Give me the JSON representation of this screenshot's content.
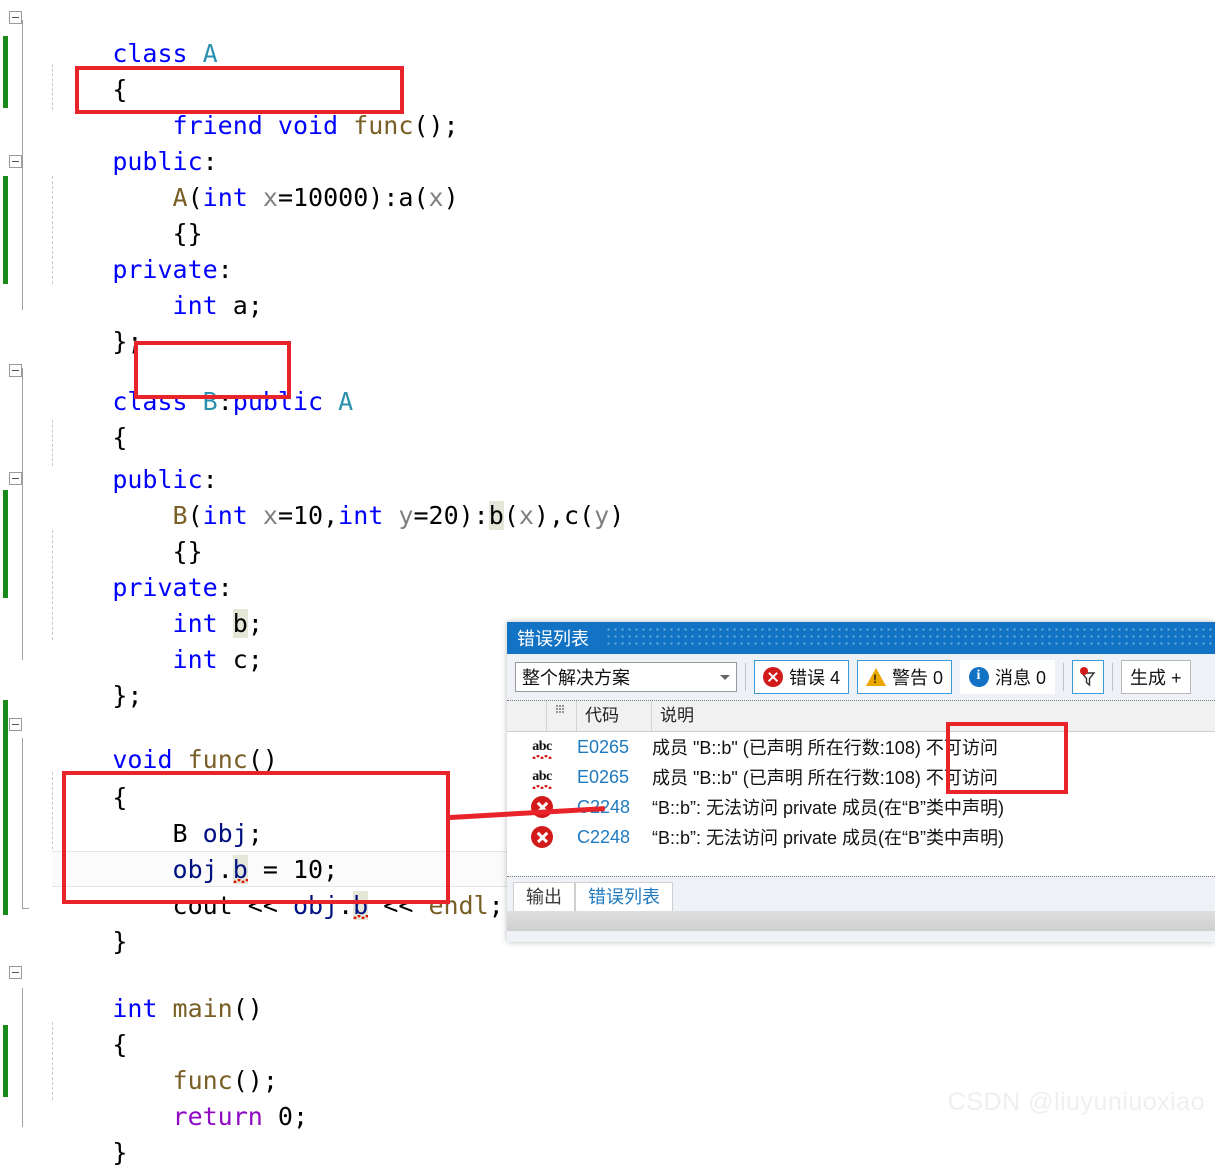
{
  "editor": {
    "language": "cpp",
    "lines": [
      {
        "indent": 0,
        "text": "class A",
        "fold": "open",
        "change": false
      },
      {
        "indent": 0,
        "text": "{",
        "fold": null,
        "change": true
      },
      {
        "indent": 1,
        "text": "friend void func();",
        "fold": null,
        "change": true
      },
      {
        "indent": 0,
        "text": "public:",
        "fold": null,
        "change": true
      },
      {
        "indent": 1,
        "text": "A(int x=10000):a(x)",
        "fold": "open",
        "change": false
      },
      {
        "indent": 1,
        "text": "{}",
        "fold": null,
        "change": true
      },
      {
        "indent": 0,
        "text": "private:",
        "fold": null,
        "change": true
      },
      {
        "indent": 1,
        "text": "int a;",
        "fold": null,
        "change": false
      },
      {
        "indent": 0,
        "text": "};",
        "fold": null,
        "change": false
      },
      {
        "indent": 0,
        "text": "",
        "fold": null,
        "change": false
      },
      {
        "indent": 0,
        "text": "class B:public A",
        "fold": "open",
        "change": false
      },
      {
        "indent": 0,
        "text": "{",
        "fold": null,
        "change": false
      },
      {
        "indent": 0,
        "text": "public:",
        "fold": null,
        "change": false
      },
      {
        "indent": 1,
        "text": "B(int x=10,int y=20):b(x),c(y)",
        "fold": "open",
        "change": false
      },
      {
        "indent": 1,
        "text": "{}",
        "fold": null,
        "change": true
      },
      {
        "indent": 0,
        "text": "private:",
        "fold": null,
        "change": true
      },
      {
        "indent": 1,
        "text": "int b;",
        "fold": null,
        "change": true
      },
      {
        "indent": 1,
        "text": "int c;",
        "fold": null,
        "change": true
      },
      {
        "indent": 0,
        "text": "};",
        "fold": null,
        "change": true
      },
      {
        "indent": 0,
        "text": "",
        "fold": null,
        "change": true
      },
      {
        "indent": 0,
        "text": "void func()",
        "fold": "open",
        "change": true
      },
      {
        "indent": 0,
        "text": "{",
        "fold": null,
        "change": true
      },
      {
        "indent": 1,
        "text": "B obj;",
        "fold": null,
        "change": true
      },
      {
        "indent": 1,
        "text": "obj.b = 10;",
        "fold": null,
        "change": true
      },
      {
        "indent": 1,
        "text": "cout << obj.b << endl;",
        "fold": null,
        "change": true
      },
      {
        "indent": 0,
        "text": "}",
        "fold": "end",
        "change": true
      },
      {
        "indent": 0,
        "text": "",
        "fold": null,
        "change": true
      },
      {
        "indent": 0,
        "text": "int main()",
        "fold": "open",
        "change": false
      },
      {
        "indent": 0,
        "text": "{",
        "fold": null,
        "change": false
      },
      {
        "indent": 1,
        "text": "func();",
        "fold": null,
        "change": true
      },
      {
        "indent": 1,
        "text": "return 0;",
        "fold": null,
        "change": true
      },
      {
        "indent": 0,
        "text": "}",
        "fold": null,
        "change": false
      }
    ]
  },
  "annotations": {
    "box_friend_decl": "friend void func();",
    "box_inheritance": "class B:public A",
    "box_func_body": "B obj; obj.b = 10; cout << obj.b << endl;",
    "box_error_col": "不可访问",
    "connector_color": "#e8232a",
    "box_color": "#e8232a"
  },
  "error_panel": {
    "title": "错误列表",
    "scope_filter": {
      "value": "整个解决方案",
      "caret_icon": "chevron-down-icon"
    },
    "counters": [
      {
        "icon": "error-icon",
        "label": "错误 4",
        "count": 4,
        "color": "#d21a1a"
      },
      {
        "icon": "warning-icon",
        "label": "警告 0",
        "count": 0,
        "color": "#e9a800"
      },
      {
        "icon": "info-icon",
        "label": "消息 0",
        "count": 0,
        "color": "#1273c4"
      }
    ],
    "filter_button": {
      "icon": "filter-funnel-icon",
      "badge": true
    },
    "build_button": {
      "label": "生成 +"
    },
    "columns": [
      "",
      "",
      "代码",
      "说明"
    ],
    "rows": [
      {
        "icon": "abc-squiggle-icon",
        "code": "E0265",
        "description": "成员 \"B::b\" (已声明 所在行数:108) 不可访问"
      },
      {
        "icon": "abc-squiggle-icon",
        "code": "E0265",
        "description": "成员 \"B::b\" (已声明 所在行数:108) 不可访问"
      },
      {
        "icon": "error-circle-icon",
        "code": "C2248",
        "description": "“B::b”: 无法访问 private 成员(在“B”类中声明)"
      },
      {
        "icon": "error-circle-icon",
        "code": "C2248",
        "description": "“B::b”: 无法访问 private 成员(在“B”类中声明)"
      }
    ],
    "tabs": [
      {
        "label": "输出",
        "active": false
      },
      {
        "label": "错误列表",
        "active": true
      }
    ]
  },
  "watermark": {
    "text": "CSDN @liuyuniuoxiao"
  }
}
